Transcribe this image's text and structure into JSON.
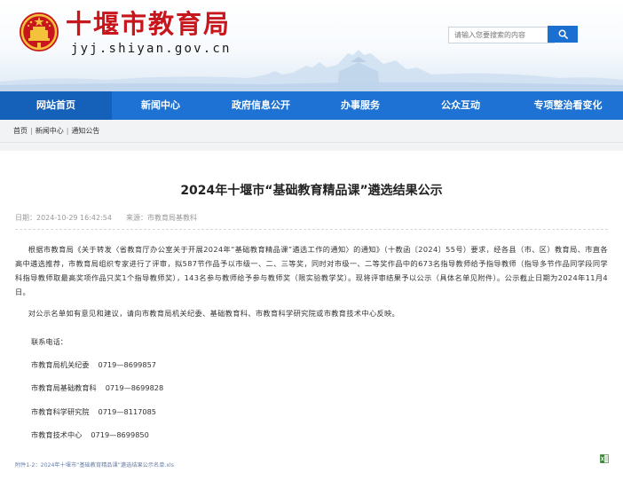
{
  "header": {
    "site_name": "十堰市教育局",
    "site_domain": "jyj.shiyan.gov.cn",
    "search_placeholder": "请输入您要搜索的内容",
    "search_icon": "search-icon",
    "emblem_icon": "national-emblem-icon"
  },
  "nav": {
    "items": [
      {
        "label": "网站首页",
        "active": true
      },
      {
        "label": "新闻中心"
      },
      {
        "label": "政府信息公开"
      },
      {
        "label": "办事服务"
      },
      {
        "label": "公众互动"
      },
      {
        "label": "专项整治看变化"
      }
    ]
  },
  "breadcrumb": {
    "home": "首页",
    "section": "新闻中心",
    "current": "通知公告",
    "separator": "|"
  },
  "article": {
    "title": "2024年十堰市“基础教育精品课”遴选结果公示",
    "date_label": "日期：",
    "date": "2024-10-29 16:42:54",
    "source_label": "来源：",
    "source": "市教育局基教科",
    "paragraph1": "根据市教育局《关于转发〈省教育厅办公室关于开展2024年“基础教育精品课”遴选工作的通知〉的通知》（十教函〔2024〕55号）要求，经各县（市、区）教育局、市直各高中遴选推荐，市教育局组织专家进行了评审，拟587节作品予以市级一、二、三等奖，同时对市级一、二等奖作品中的673名指导教师给予指导教师（指导多节作品同学段同学科指导教师取最高奖项作品只奖1个指导教师奖），143名参与教师给予参与教师奖（限实验教学奖）。现将评审结果予以公示（具体名单见附件）。公示截止日期为2024年11月4日。",
    "paragraph2": "对公示名单如有意见和建议，请向市教育局机关纪委、基础教育科、市教育科学研究院或市教育技术中心反映。",
    "contact_heading": "联系电话：",
    "contacts": [
      {
        "dept": "市教育局机关纪委",
        "phone": "0719—8699857"
      },
      {
        "dept": "市教育局基础教育科",
        "phone": "0719—8699828"
      },
      {
        "dept": "市教育科学研究院",
        "phone": "0719—8117085"
      },
      {
        "dept": "市教育技术中心",
        "phone": "0719—8699850"
      }
    ],
    "attachment": "附件1-2：2024年十堰市“基础教育精品课”遴选结果公示名单.xls",
    "attachment_icon": "excel-file-icon"
  },
  "colors": {
    "brand_red": "#c8161d",
    "nav_blue": "#1d72d3",
    "nav_active": "#1560b8",
    "search_button": "#1b6fd1"
  }
}
